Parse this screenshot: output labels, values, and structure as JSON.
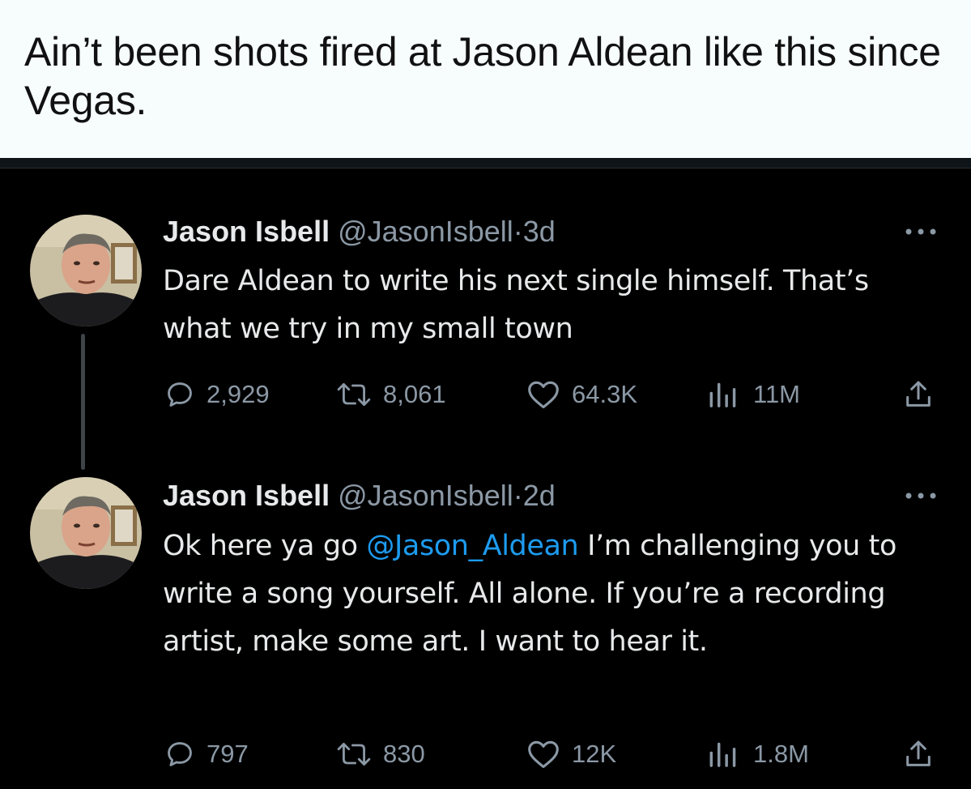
{
  "caption": "Ain’t been shots fired at Jason Aldean like this since Vegas.",
  "tweets": [
    {
      "name": "Jason Isbell",
      "handle": "@JasonIsbell",
      "dot": "·",
      "time": "3d",
      "text": "Dare Aldean to write his next single himself. That’s what we try in my small town",
      "replies": "2,929",
      "retweets": "8,061",
      "likes": "64.3K",
      "views": "11M"
    },
    {
      "name": "Jason Isbell",
      "handle": "@JasonIsbell",
      "dot": "·",
      "time": "2d",
      "text_before": "Ok here ya go ",
      "mention": "@Jason_Aldean",
      "text_after": " I’m challenging you to write a song yourself. All alone. If you’re a recording artist, make some art. I want to hear it.",
      "replies": "797",
      "retweets": "830",
      "likes": "12K",
      "views": "1.8M"
    }
  ],
  "colors": {
    "background": "#000000",
    "caption_background": "#f7fdfd",
    "text": "#e7e9ea",
    "secondary": "#8b98a5",
    "link": "#1d9bf0"
  }
}
